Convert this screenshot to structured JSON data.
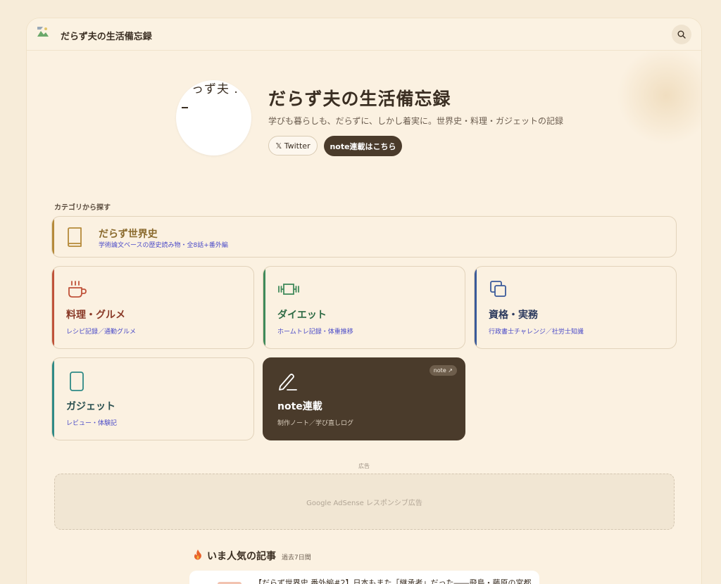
{
  "header": {
    "site_name": "だらず夫の生活備忘録",
    "search_icon": "search-icon"
  },
  "hero": {
    "avatar_text": "っず夫 .",
    "title": "だらず夫の生活備忘録",
    "tagline": "学びも暮らしも、だらずに、しかし着実に。世界史・料理・ガジェットの記録",
    "twitter_label": "𝕏 Twitter",
    "note_label": "note連載はこちら"
  },
  "categories": {
    "section_label": "カテゴリから探す",
    "items": [
      {
        "title": "だらず世界史",
        "subtitle": "学術論文ベースの歴史読み物・全8話+番外編",
        "icon": "book-icon",
        "color": "#b58a3a"
      },
      {
        "title": "料理・グルメ",
        "subtitle": "レシピ記録／通勤グルメ",
        "icon": "coffee-cup-icon",
        "color": "#c0533a"
      },
      {
        "title": "ダイエット",
        "subtitle": "ホームトレ記録・体重推移",
        "icon": "dumbbell-icon",
        "color": "#3f8a5a"
      },
      {
        "title": "資格・実務",
        "subtitle": "行政書士チャレンジ／社労士知識",
        "icon": "copy-icon",
        "color": "#3a5a9a"
      },
      {
        "title": "ガジェット",
        "subtitle": "レビュー・体験記",
        "icon": "smartphone-icon",
        "color": "#2f8a86"
      },
      {
        "title": "note連載",
        "subtitle": "制作ノート／学び直しログ",
        "icon": "pen-icon",
        "badge": "note ↗",
        "color": "#4a3b2b"
      }
    ]
  },
  "ad": {
    "label": "広告",
    "placeholder": "Google AdSense レスポンシブ広告"
  },
  "popular": {
    "icon": "fire-icon",
    "title": "いま人気の記事",
    "period": "過去7日間",
    "articles": [
      {
        "title": "【だらず世界史 番外編#2】日本もまた「継承者」だった――飛鳥・藤原の宮都"
      }
    ]
  }
}
